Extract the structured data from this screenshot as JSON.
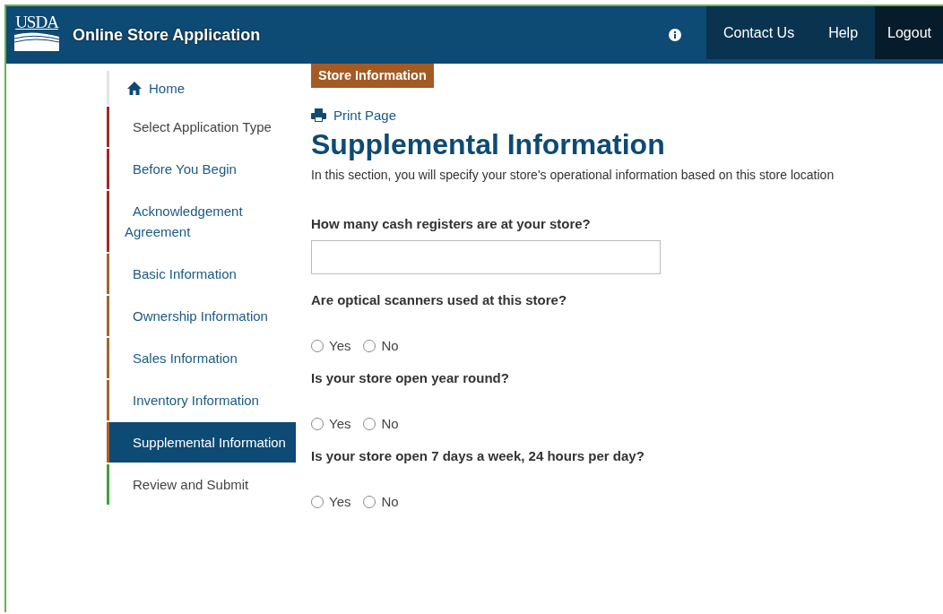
{
  "header": {
    "logo": "USDA",
    "title": "Online Store Application",
    "nav": [
      {
        "label": "Contact Us",
        "selected": false
      },
      {
        "label": "Help",
        "selected": false
      },
      {
        "label": "Logout",
        "selected": true
      }
    ]
  },
  "sidebar": {
    "home": "Home",
    "items": [
      {
        "label": "Select Application Type",
        "kind": "text",
        "color": "#a4282a",
        "selected": false
      },
      {
        "label": "Before You Begin",
        "kind": "link",
        "color": "#a4282a",
        "selected": false
      },
      {
        "label": "Acknowledgement Agreement",
        "kind": "link",
        "color": "#a4282a",
        "selected": false
      },
      {
        "label": "Basic Information",
        "kind": "link",
        "color": "#a8622a",
        "selected": false
      },
      {
        "label": "Ownership Information",
        "kind": "link",
        "color": "#a8622a",
        "selected": false
      },
      {
        "label": "Sales Information",
        "kind": "link",
        "color": "#a8622a",
        "selected": false
      },
      {
        "label": "Inventory Information",
        "kind": "link",
        "color": "#a8622a",
        "selected": false
      },
      {
        "label": "Supplemental Information",
        "kind": "link",
        "color": "#a8622a",
        "selected": true
      },
      {
        "label": "Review and Submit",
        "kind": "text",
        "color": "#3aa43a",
        "selected": false
      }
    ]
  },
  "content": {
    "section_badge": "Store Information",
    "print_link": "Print Page",
    "heading": "Supplemental Information",
    "description": "In this section, you will specify your store's operational information based on this store location",
    "questions": [
      {
        "kind": "text",
        "label": "How many cash registers are at your store?"
      },
      {
        "kind": "radio",
        "label": "Are optical scanners used at this store?",
        "options": [
          {
            "label": "Yes",
            "selected": false
          },
          {
            "label": "No",
            "selected": false
          }
        ]
      },
      {
        "kind": "radio",
        "label": "Is your store open year round?",
        "options": [
          {
            "label": "Yes",
            "selected": false
          },
          {
            "label": "No",
            "selected": false
          }
        ]
      },
      {
        "kind": "radio",
        "label": "Is your store open 7 days a week, 24 hours per day?",
        "options": [
          {
            "label": "Yes",
            "selected": false
          },
          {
            "label": "No",
            "selected": false
          }
        ]
      }
    ]
  }
}
